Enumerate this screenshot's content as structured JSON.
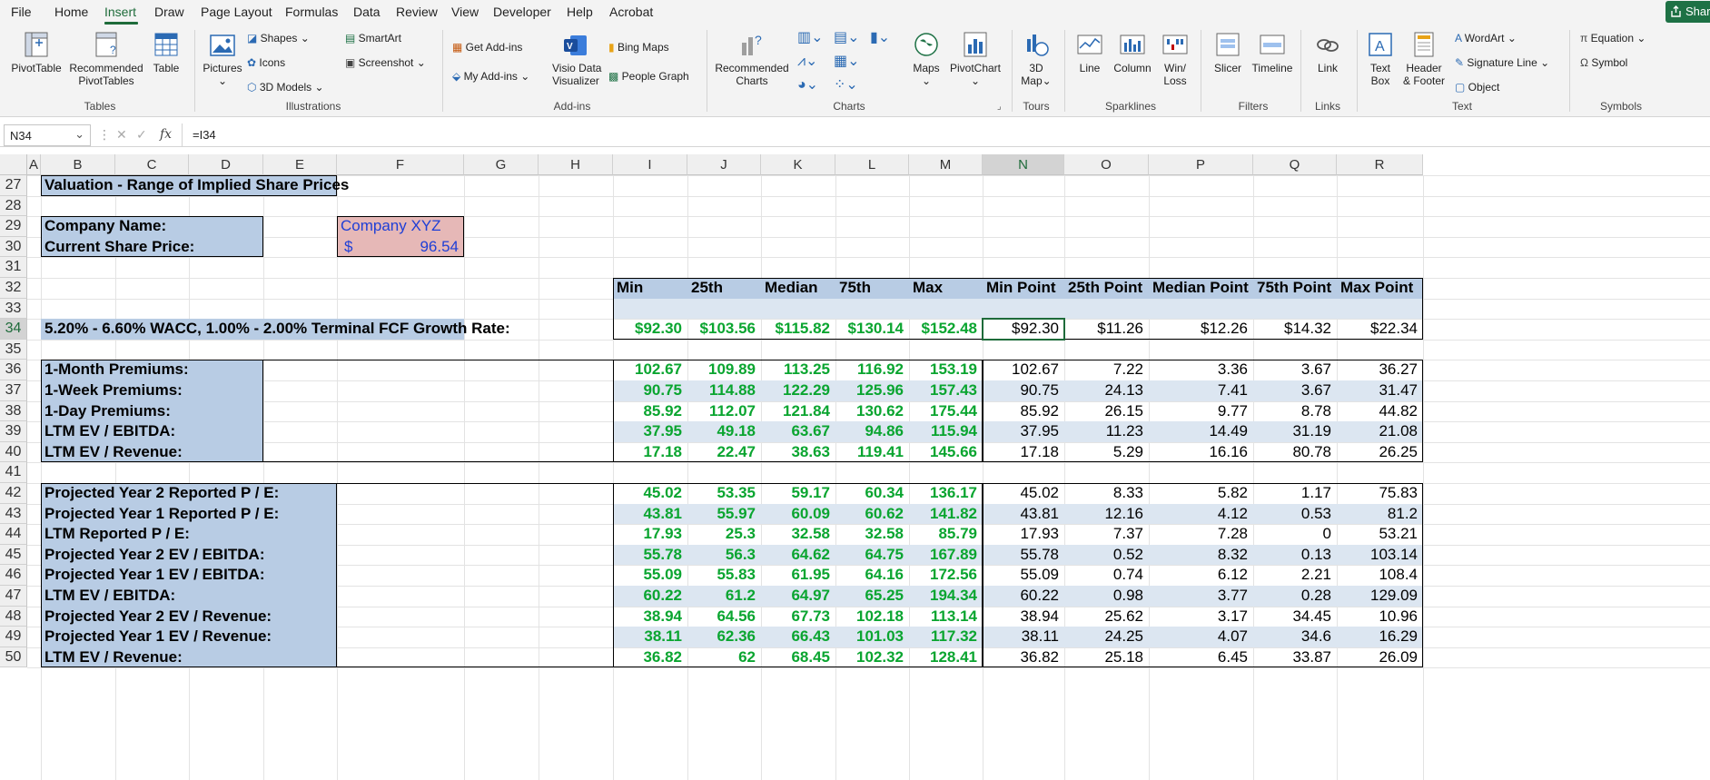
{
  "menu": {
    "items": [
      "File",
      "Home",
      "Insert",
      "Draw",
      "Page Layout",
      "Formulas",
      "Data",
      "Review",
      "View",
      "Developer",
      "Help",
      "Acrobat"
    ],
    "active": "Insert",
    "share_label": "Share"
  },
  "ribbon": {
    "groups": [
      "Tables",
      "Illustrations",
      "Add-ins",
      "Charts",
      "Tours",
      "Sparklines",
      "Filters",
      "Links",
      "Text",
      "Symbols"
    ],
    "pivottable": "PivotTable",
    "recommended_pivottables_1": "Recommended",
    "recommended_pivottables_2": "PivotTables",
    "table": "Table",
    "pictures": "Pictures",
    "shapes": "Shapes",
    "icons": "Icons",
    "models_3d": "3D Models",
    "smartart": "SmartArt",
    "screenshot": "Screenshot",
    "get_addins": "Get Add-ins",
    "my_addins": "My Add-ins",
    "visio_1": "Visio Data",
    "visio_2": "Visualizer",
    "bing_maps": "Bing Maps",
    "people_graph": "People Graph",
    "recommended_charts_1": "Recommended",
    "recommended_charts_2": "Charts",
    "maps": "Maps",
    "pivotchart": "PivotChart",
    "map3d_1": "3D",
    "map3d_2": "Map",
    "line": "Line",
    "column": "Column",
    "winloss_1": "Win/",
    "winloss_2": "Loss",
    "slicer": "Slicer",
    "timeline": "Timeline",
    "link": "Link",
    "textbox_1": "Text",
    "textbox_2": "Box",
    "header_1": "Header",
    "header_2": "& Footer",
    "wordart": "WordArt",
    "signature": "Signature Line",
    "object": "Object",
    "equation": "Equation",
    "symbol": "Symbol"
  },
  "formula_bar": {
    "name_box": "N34",
    "fx": "fx",
    "formula": "=I34"
  },
  "columns": [
    "A",
    "B",
    "C",
    "D",
    "E",
    "F",
    "G",
    "H",
    "I",
    "J",
    "K",
    "L",
    "M",
    "N",
    "O",
    "P",
    "Q",
    "R"
  ],
  "rows": [
    "27",
    "28",
    "29",
    "30",
    "31",
    "32",
    "33",
    "34",
    "35",
    "36",
    "37",
    "38",
    "39",
    "40",
    "41",
    "42",
    "43",
    "44",
    "45",
    "46",
    "47",
    "48",
    "49",
    "50"
  ],
  "sheet": {
    "title": "Valuation - Range of Implied Share Prices",
    "company_name_label": "Company Name:",
    "company_name_value": "Company XYZ",
    "share_price_label": "Current Share Price:",
    "share_price_currency": "$",
    "share_price_value": "96.54",
    "headers": [
      "Min",
      "25th",
      "Median",
      "75th",
      "Max",
      "Min Point",
      "25th Point",
      "Median Point",
      "75th Point",
      "Max Point"
    ],
    "dcf_label": "5.20% - 6.60% WACC, 1.00% - 2.00% Terminal FCF Growth Rate:",
    "dcf_values": [
      "$92.30",
      "$103.56",
      "$115.82",
      "$130.14",
      "$152.48",
      "$92.30",
      "$11.26",
      "$12.26",
      "$14.32",
      "$22.34"
    ],
    "premiums": [
      {
        "label": "1-Month Premiums:",
        "values": [
          "102.67",
          "109.89",
          "113.25",
          "116.92",
          "153.19",
          "102.67",
          "7.22",
          "3.36",
          "3.67",
          "36.27"
        ]
      },
      {
        "label": "1-Week Premiums:",
        "values": [
          "90.75",
          "114.88",
          "122.29",
          "125.96",
          "157.43",
          "90.75",
          "24.13",
          "7.41",
          "3.67",
          "31.47"
        ]
      },
      {
        "label": "1-Day Premiums:",
        "values": [
          "85.92",
          "112.07",
          "121.84",
          "130.62",
          "175.44",
          "85.92",
          "26.15",
          "9.77",
          "8.78",
          "44.82"
        ]
      },
      {
        "label": "LTM EV / EBITDA:",
        "values": [
          "37.95",
          "49.18",
          "63.67",
          "94.86",
          "115.94",
          "37.95",
          "11.23",
          "14.49",
          "31.19",
          "21.08"
        ]
      },
      {
        "label": "LTM EV / Revenue:",
        "values": [
          "17.18",
          "22.47",
          "38.63",
          "119.41",
          "145.66",
          "17.18",
          "5.29",
          "16.16",
          "80.78",
          "26.25"
        ]
      }
    ],
    "multiples": [
      {
        "label": "Projected Year 2 Reported P / E:",
        "values": [
          "45.02",
          "53.35",
          "59.17",
          "60.34",
          "136.17",
          "45.02",
          "8.33",
          "5.82",
          "1.17",
          "75.83"
        ]
      },
      {
        "label": "Projected Year 1 Reported P / E:",
        "values": [
          "43.81",
          "55.97",
          "60.09",
          "60.62",
          "141.82",
          "43.81",
          "12.16",
          "4.12",
          "0.53",
          "81.2"
        ]
      },
      {
        "label": "LTM Reported P / E:",
        "values": [
          "17.93",
          "25.3",
          "32.58",
          "32.58",
          "85.79",
          "17.93",
          "7.37",
          "7.28",
          "0",
          "53.21"
        ]
      },
      {
        "label": "Projected Year 2 EV / EBITDA:",
        "values": [
          "55.78",
          "56.3",
          "64.62",
          "64.75",
          "167.89",
          "55.78",
          "0.52",
          "8.32",
          "0.13",
          "103.14"
        ]
      },
      {
        "label": "Projected Year 1 EV / EBITDA:",
        "values": [
          "55.09",
          "55.83",
          "61.95",
          "64.16",
          "172.56",
          "55.09",
          "0.74",
          "6.12",
          "2.21",
          "108.4"
        ]
      },
      {
        "label": "LTM EV / EBITDA:",
        "values": [
          "60.22",
          "61.2",
          "64.97",
          "65.25",
          "194.34",
          "60.22",
          "0.98",
          "3.77",
          "0.28",
          "129.09"
        ]
      },
      {
        "label": "Projected Year 2 EV / Revenue:",
        "values": [
          "38.94",
          "64.56",
          "67.73",
          "102.18",
          "113.14",
          "38.94",
          "25.62",
          "3.17",
          "34.45",
          "10.96"
        ]
      },
      {
        "label": "Projected Year 1 EV / Revenue:",
        "values": [
          "38.11",
          "62.36",
          "66.43",
          "101.03",
          "117.32",
          "38.11",
          "24.25",
          "4.07",
          "34.6",
          "16.29"
        ]
      },
      {
        "label": "LTM EV / Revenue:",
        "values": [
          "36.82",
          "62",
          "68.45",
          "102.32",
          "128.41",
          "36.82",
          "25.18",
          "6.45",
          "33.87",
          "26.09"
        ]
      }
    ]
  },
  "colors": {
    "label_fill": "#b8cce4",
    "alt_row_fill": "#dce6f1",
    "company_fill": "#e6b8b7",
    "green_text": "#0aa530",
    "blue_text": "#1f3fd6",
    "accent": "#1e6b3a"
  }
}
